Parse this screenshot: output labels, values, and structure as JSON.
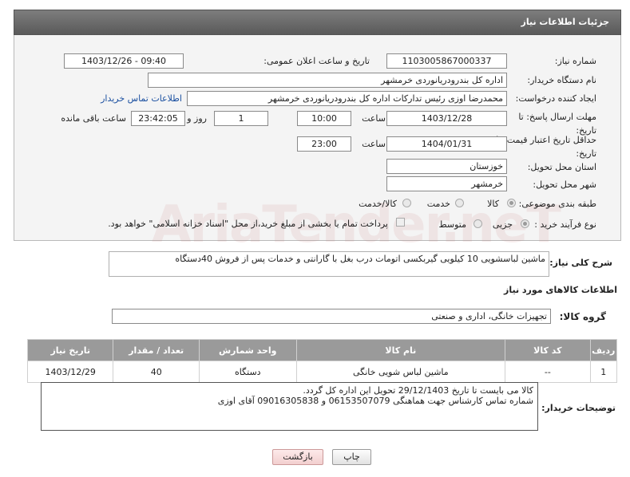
{
  "header": {
    "title": "جزئیات اطلاعات نیاز"
  },
  "fields": {
    "need_number_label": "شماره نیاز:",
    "need_number": "1103005867000337",
    "announce_label": "تاریخ و ساعت اعلان عمومی:",
    "announce_value": "1403/12/26 - 09:40",
    "buyer_label": "نام دستگاه خریدار:",
    "buyer_value": "اداره کل بندرودریانوردی خرمشهر",
    "creator_label": "ایجاد کننده درخواست:",
    "creator_value": "محمدرضا اوزی رئیس تدارکات اداره کل بندرودریانوردی خرمشهر",
    "contact_link": "اطلاعات تماس خریدار",
    "deadline_label": "مهلت ارسال پاسخ: تا تاریخ:",
    "deadline_date": "1403/12/28",
    "time_label": "ساعت",
    "deadline_time": "10:00",
    "days_value": "1",
    "days_label": "روز و",
    "remaining_time": "23:42:05",
    "remaining_label": "ساعت باقی مانده",
    "validity_label": "حداقل تاریخ اعتبار قیمت: تا تاریخ:",
    "validity_date": "1404/01/31",
    "validity_time": "23:00",
    "province_label": "استان محل تحویل:",
    "province_value": "خوزستان",
    "city_label": "شهر محل تحویل:",
    "city_value": "خرمشهر",
    "category_label": "طبقه بندی موضوعی:",
    "category_options": [
      "کالا",
      "خدمت",
      "کالا/خدمت"
    ],
    "process_label": "نوع فرآیند خرید :",
    "process_options": [
      "جزیی",
      "متوسط"
    ],
    "payment_note": "پرداخت تمام یا بخشی از مبلغ خرید،از محل \"اسناد خزانه اسلامی\" خواهد بود."
  },
  "description": {
    "label": "شرح کلی نیاز:",
    "value": "ماشین لباسشویی  10  کیلویی  گیربکسی اتومات    درب بغل با گارانتی و خدمات پس از فروش    40دستگاه"
  },
  "goods_section_title": "اطلاعات کالاهای مورد نیاز",
  "goods_group": {
    "label": "گروه کالا:",
    "value": "تجهیزات خانگی، اداری و صنعتی"
  },
  "table": {
    "headers": [
      "ردیف",
      "کد کالا",
      "نام کالا",
      "واحد شمارش",
      "تعداد / مقدار",
      "تاریخ نیاز"
    ],
    "rows": [
      [
        "1",
        "--",
        "ماشین لباس شویی خانگی",
        "دستگاه",
        "40",
        "1403/12/29"
      ]
    ]
  },
  "buyer_notes": {
    "label": "توضیحات خریدار:",
    "line1": "کالا می بایست تا تاریخ 29/12/1403 تحویل این اداره کل گردد.",
    "line2": "شماره تماس کارشناس جهت هماهنگی 06153507079 و 09016305838  آقای اوزی"
  },
  "buttons": {
    "print": "چاپ",
    "back": "بازگشت"
  },
  "watermark": "AriaTender.neT",
  "colors": {
    "header": "#6b6b6b",
    "link": "#1a4fa0",
    "back_button": "#f7dada"
  }
}
